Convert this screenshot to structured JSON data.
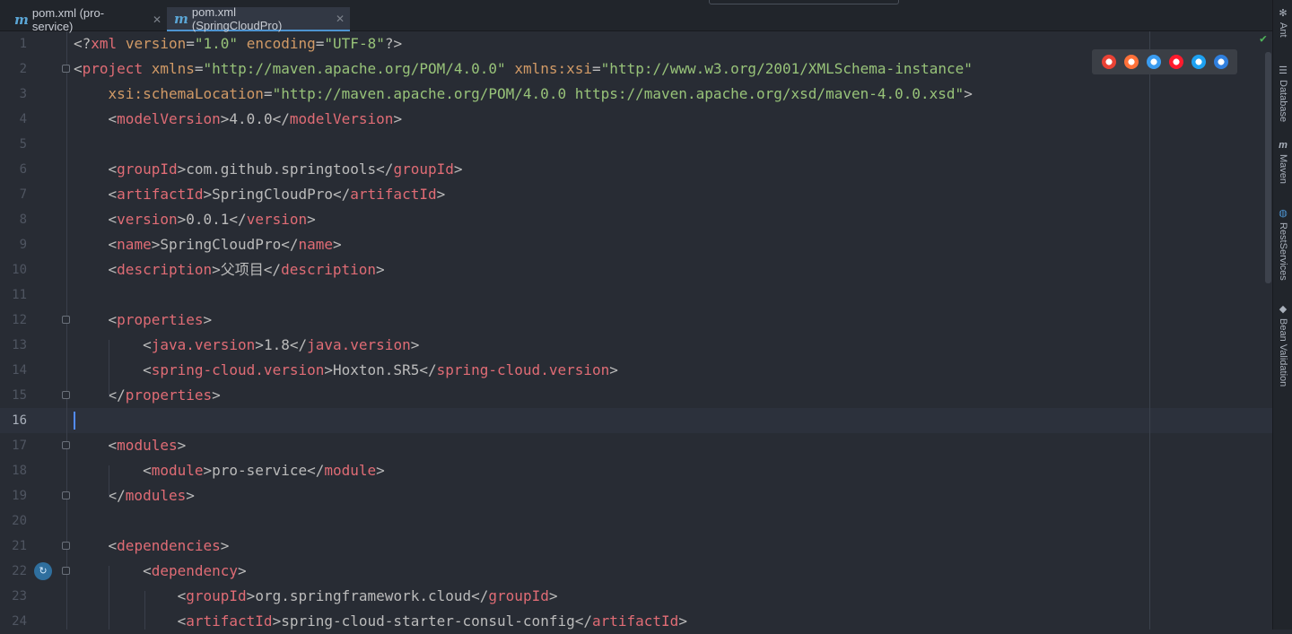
{
  "tabs": [
    {
      "label": "pom.xml (pro-service)",
      "icon": "maven-icon",
      "active": false
    },
    {
      "label": "pom.xml (SpringCloudPro)",
      "icon": "maven-icon",
      "active": true
    }
  ],
  "editor": {
    "current_line": 16,
    "lines": [
      {
        "n": "1",
        "tokens": [
          [
            "t-pun",
            "<?"
          ],
          [
            "t-tag",
            "xml"
          ],
          [
            "t-pun",
            " "
          ],
          [
            "t-attr",
            "version"
          ],
          [
            "t-pun",
            "="
          ],
          [
            "t-str",
            "\"1.0\""
          ],
          [
            "t-pun",
            " "
          ],
          [
            "t-attr",
            "encoding"
          ],
          [
            "t-pun",
            "="
          ],
          [
            "t-str",
            "\"UTF-8\""
          ],
          [
            "t-pun",
            "?>"
          ]
        ]
      },
      {
        "n": "2",
        "tokens": [
          [
            "t-pun",
            "<"
          ],
          [
            "t-tag",
            "project"
          ],
          [
            "t-pun",
            " "
          ],
          [
            "t-attr",
            "xmlns"
          ],
          [
            "t-pun",
            "="
          ],
          [
            "t-str",
            "\"http://maven.apache.org/POM/4.0.0\""
          ],
          [
            "t-pun",
            " "
          ],
          [
            "t-attr",
            "xmlns:xsi"
          ],
          [
            "t-pun",
            "="
          ],
          [
            "t-str",
            "\"http://www.w3.org/2001/XMLSchema-instance\""
          ]
        ]
      },
      {
        "n": "3",
        "tokens": [
          [
            "t-pun",
            "    "
          ],
          [
            "t-attr",
            "xsi:schemaLocation"
          ],
          [
            "t-pun",
            "="
          ],
          [
            "t-str",
            "\"http://maven.apache.org/POM/4.0.0 https://maven.apache.org/xsd/maven-4.0.0.xsd\""
          ],
          [
            "t-pun",
            ">"
          ]
        ]
      },
      {
        "n": "4",
        "tokens": [
          [
            "t-pun",
            "    <"
          ],
          [
            "t-tag",
            "modelVersion"
          ],
          [
            "t-pun",
            ">"
          ],
          [
            "t-txt",
            "4.0.0"
          ],
          [
            "t-pun",
            "</"
          ],
          [
            "t-tag",
            "modelVersion"
          ],
          [
            "t-pun",
            ">"
          ]
        ]
      },
      {
        "n": "5",
        "tokens": []
      },
      {
        "n": "6",
        "tokens": [
          [
            "t-pun",
            "    <"
          ],
          [
            "t-tag",
            "groupId"
          ],
          [
            "t-pun",
            ">"
          ],
          [
            "t-txt",
            "com.github.springtools"
          ],
          [
            "t-pun",
            "</"
          ],
          [
            "t-tag",
            "groupId"
          ],
          [
            "t-pun",
            ">"
          ]
        ]
      },
      {
        "n": "7",
        "tokens": [
          [
            "t-pun",
            "    <"
          ],
          [
            "t-tag",
            "artifactId"
          ],
          [
            "t-pun",
            ">"
          ],
          [
            "t-txt",
            "SpringCloudPro"
          ],
          [
            "t-pun",
            "</"
          ],
          [
            "t-tag",
            "artifactId"
          ],
          [
            "t-pun",
            ">"
          ]
        ]
      },
      {
        "n": "8",
        "tokens": [
          [
            "t-pun",
            "    <"
          ],
          [
            "t-tag",
            "version"
          ],
          [
            "t-pun",
            ">"
          ],
          [
            "t-txt",
            "0.0.1"
          ],
          [
            "t-pun",
            "</"
          ],
          [
            "t-tag",
            "version"
          ],
          [
            "t-pun",
            ">"
          ]
        ]
      },
      {
        "n": "9",
        "tokens": [
          [
            "t-pun",
            "    <"
          ],
          [
            "t-tag",
            "name"
          ],
          [
            "t-pun",
            ">"
          ],
          [
            "t-txt",
            "SpringCloudPro"
          ],
          [
            "t-pun",
            "</"
          ],
          [
            "t-tag",
            "name"
          ],
          [
            "t-pun",
            ">"
          ]
        ]
      },
      {
        "n": "10",
        "tokens": [
          [
            "t-pun",
            "    <"
          ],
          [
            "t-tag",
            "description"
          ],
          [
            "t-pun",
            ">"
          ],
          [
            "t-txt",
            "父项目"
          ],
          [
            "t-pun",
            "</"
          ],
          [
            "t-tag",
            "description"
          ],
          [
            "t-pun",
            ">"
          ]
        ]
      },
      {
        "n": "11",
        "tokens": []
      },
      {
        "n": "12",
        "tokens": [
          [
            "t-pun",
            "    <"
          ],
          [
            "t-tag",
            "properties"
          ],
          [
            "t-pun",
            ">"
          ]
        ]
      },
      {
        "n": "13",
        "tokens": [
          [
            "t-pun",
            "        <"
          ],
          [
            "t-tag",
            "java.version"
          ],
          [
            "t-pun",
            ">"
          ],
          [
            "t-txt",
            "1.8"
          ],
          [
            "t-pun",
            "</"
          ],
          [
            "t-tag",
            "java.version"
          ],
          [
            "t-pun",
            ">"
          ]
        ]
      },
      {
        "n": "14",
        "tokens": [
          [
            "t-pun",
            "        <"
          ],
          [
            "t-tag",
            "spring-cloud.version"
          ],
          [
            "t-pun",
            ">"
          ],
          [
            "t-txt",
            "Hoxton.SR5"
          ],
          [
            "t-pun",
            "</"
          ],
          [
            "t-tag",
            "spring-cloud.version"
          ],
          [
            "t-pun",
            ">"
          ]
        ]
      },
      {
        "n": "15",
        "tokens": [
          [
            "t-pun",
            "    </"
          ],
          [
            "t-tag",
            "properties"
          ],
          [
            "t-pun",
            ">"
          ]
        ]
      },
      {
        "n": "16",
        "tokens": []
      },
      {
        "n": "17",
        "tokens": [
          [
            "t-pun",
            "    <"
          ],
          [
            "t-tag",
            "modules"
          ],
          [
            "t-pun",
            ">"
          ]
        ]
      },
      {
        "n": "18",
        "tokens": [
          [
            "t-pun",
            "        <"
          ],
          [
            "t-tag",
            "module"
          ],
          [
            "t-pun",
            ">"
          ],
          [
            "t-txt",
            "pro-service"
          ],
          [
            "t-pun",
            "</"
          ],
          [
            "t-tag",
            "module"
          ],
          [
            "t-pun",
            ">"
          ]
        ]
      },
      {
        "n": "19",
        "tokens": [
          [
            "t-pun",
            "    </"
          ],
          [
            "t-tag",
            "modules"
          ],
          [
            "t-pun",
            ">"
          ]
        ]
      },
      {
        "n": "20",
        "tokens": []
      },
      {
        "n": "21",
        "tokens": [
          [
            "t-pun",
            "    <"
          ],
          [
            "t-tag",
            "dependencies"
          ],
          [
            "t-pun",
            ">"
          ]
        ]
      },
      {
        "n": "22",
        "tokens": [
          [
            "t-pun",
            "        <"
          ],
          [
            "t-tag",
            "dependency"
          ],
          [
            "t-pun",
            ">"
          ]
        ]
      },
      {
        "n": "23",
        "tokens": [
          [
            "t-pun",
            "            <"
          ],
          [
            "t-tag",
            "groupId"
          ],
          [
            "t-pun",
            ">"
          ],
          [
            "t-txt",
            "org.springframework.cloud"
          ],
          [
            "t-pun",
            "</"
          ],
          [
            "t-tag",
            "groupId"
          ],
          [
            "t-pun",
            ">"
          ]
        ]
      },
      {
        "n": "24",
        "tokens": [
          [
            "t-pun",
            "            <"
          ],
          [
            "t-tag",
            "artifactId"
          ],
          [
            "t-pun",
            ">"
          ],
          [
            "t-txt",
            "spring-cloud-starter-consul-config"
          ],
          [
            "t-pun",
            "</"
          ],
          [
            "t-tag",
            "artifactId"
          ],
          [
            "t-pun",
            ">"
          ]
        ]
      }
    ]
  },
  "browser_icons": [
    {
      "name": "chrome-icon",
      "color": "#e94235"
    },
    {
      "name": "firefox-icon",
      "color": "#ff7139"
    },
    {
      "name": "safari-icon",
      "color": "#3a9cf0"
    },
    {
      "name": "opera-icon",
      "color": "#ff1b2d"
    },
    {
      "name": "ie-icon",
      "color": "#1ea1f1"
    },
    {
      "name": "edge-icon",
      "color": "#2f7fde"
    }
  ],
  "tool_strip": [
    {
      "label": "Ant",
      "icon": "ant-icon"
    },
    {
      "label": "Database",
      "icon": "database-icon"
    },
    {
      "label": "Maven",
      "icon": "maven-icon"
    },
    {
      "label": "RestServices",
      "icon": "restservices-icon"
    },
    {
      "label": "Bean Validation",
      "icon": "bean-validation-icon"
    }
  ]
}
